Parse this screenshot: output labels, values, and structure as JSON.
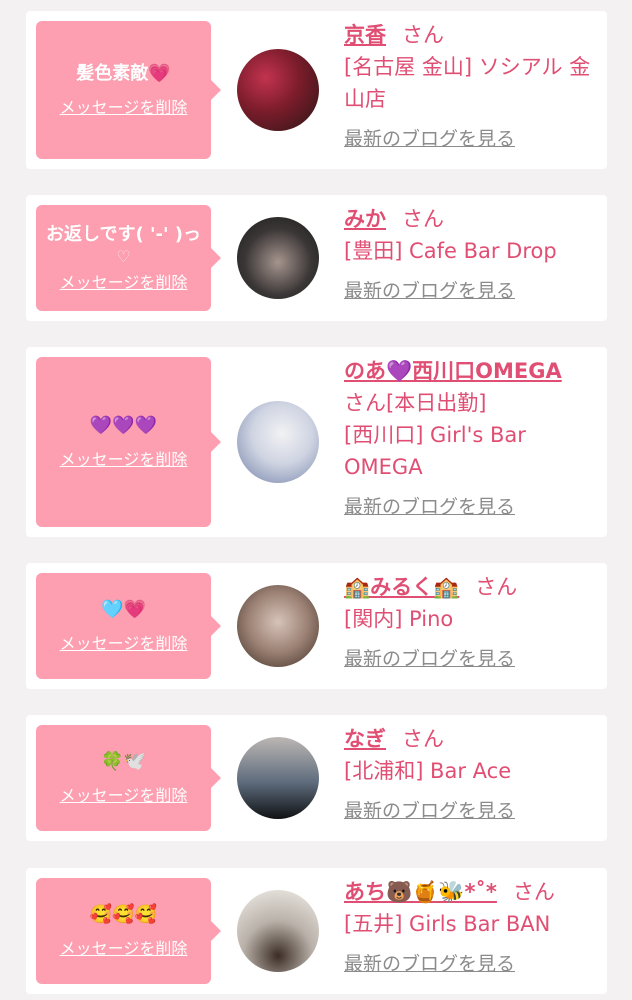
{
  "items": [
    {
      "message": "髪色素敵💗",
      "message_extra": "",
      "delete_label": "メッセージを削除",
      "name": "京香",
      "san": "さん",
      "store": "[名古屋 金山] ソシアル 金山店",
      "blog_label": "最新のブログを見る",
      "avatar_colors": [
        "#7b1c2b",
        "#c2334f",
        "#2a1614"
      ]
    },
    {
      "message": "お返しです( '-' )っ",
      "message_extra": "♡",
      "delete_label": "メッセージを削除",
      "name": "みか",
      "san": "さん",
      "store": "[豊田] Cafe Bar Drop",
      "blog_label": "最新のブログを見る",
      "avatar_colors": [
        "#3a3636",
        "#a6958e",
        "#1c1a1a"
      ]
    },
    {
      "message": "💜💜💜",
      "message_extra": "",
      "delete_label": "メッセージを削除",
      "name": "のあ💜西川口OMEGA",
      "san": "さん[本日出勤]",
      "store": "[西川口] Girl's Bar OMEGA",
      "blog_label": "最新のブログを見る",
      "avatar_colors": [
        "#cfd4e2",
        "#6f7ea6",
        "#f2f2f4"
      ]
    },
    {
      "message": "🩵💗",
      "message_extra": "",
      "delete_label": "メッセージを削除",
      "name": "🏫みるく🏫",
      "san": "さん",
      "store": "[関内] Pino",
      "blog_label": "最新のブログを見る",
      "avatar_colors": [
        "#9a8073",
        "#d7c3b9",
        "#3d2b23"
      ]
    },
    {
      "message": "🍀🕊️",
      "message_extra": "",
      "delete_label": "メッセージを削除",
      "name": "なぎ",
      "san": "さん",
      "store": "[北浦和] Bar Ace",
      "blog_label": "最新のブログを見る",
      "avatar_colors": [
        "#bcb7b4",
        "#5e6c7d",
        "#101214"
      ]
    },
    {
      "message": "🥰🥰🥰",
      "message_extra": "",
      "delete_label": "メッセージを削除",
      "name": "あち🐻🍯🐝*˚*",
      "san": "さん",
      "store": "[五井] Girls Bar BAN",
      "blog_label": "最新のブログを見る",
      "avatar_colors": [
        "#f2efea",
        "#b9b1a9",
        "#3b2d26"
      ]
    }
  ]
}
